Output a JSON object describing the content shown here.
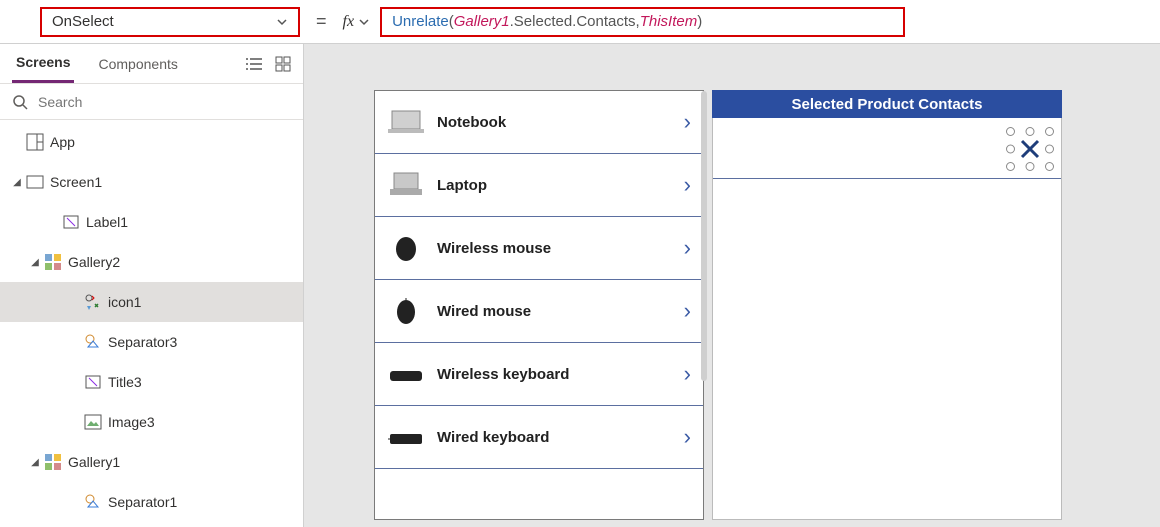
{
  "property_selector": {
    "value": "OnSelect"
  },
  "formula": {
    "fn": "Unrelate",
    "open": "( ",
    "id1": "Gallery1",
    "after_id1": ".Selected.Contacts, ",
    "id2": "ThisItem",
    "close": " )"
  },
  "left_panel": {
    "tabs": {
      "screens": "Screens",
      "components": "Components"
    },
    "search_placeholder": "Search",
    "tree": {
      "app": "App",
      "screen1": "Screen1",
      "label1": "Label1",
      "gallery2": "Gallery2",
      "icon1": "icon1",
      "separator3": "Separator3",
      "title3": "Title3",
      "image3": "Image3",
      "gallery1": "Gallery1",
      "separator1": "Separator1"
    }
  },
  "canvas": {
    "products": [
      {
        "name": "Notebook"
      },
      {
        "name": "Laptop"
      },
      {
        "name": "Wireless mouse"
      },
      {
        "name": "Wired mouse"
      },
      {
        "name": "Wireless keyboard"
      },
      {
        "name": "Wired keyboard"
      }
    ],
    "contacts_header": "Selected Product Contacts"
  }
}
